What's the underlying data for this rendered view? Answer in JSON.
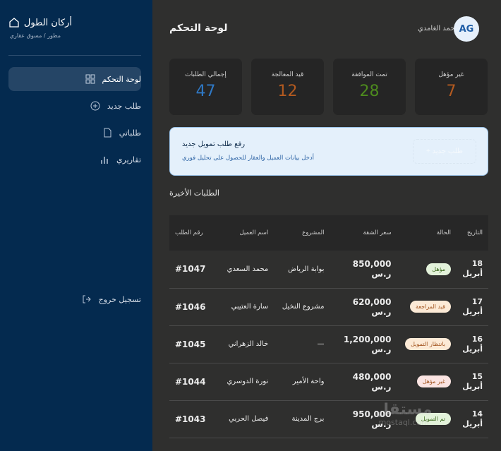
{
  "sidebar": {
    "brand": "أركان الطول",
    "subtitle": "مطور / مسوق عقاري",
    "items": [
      {
        "label": "لوحة التحكم",
        "icon": "grid-icon"
      },
      {
        "label": "طلب جديد",
        "icon": "plus-circle-icon"
      },
      {
        "label": "طلباتي",
        "icon": "file-icon"
      },
      {
        "label": "تقاريري",
        "icon": "bar-chart-icon"
      }
    ],
    "logout": "تسجيل خروج"
  },
  "header": {
    "title": "لوحة التحكم",
    "user_name": "أحمد الغامدي",
    "avatar_initials": "AG"
  },
  "stats": [
    {
      "label": "إجمالي الطلبات",
      "value": "47",
      "color": "#2f78c4"
    },
    {
      "label": "قيد المعالجة",
      "value": "12",
      "color": "#b35a20"
    },
    {
      "label": "تمت الموافقة",
      "value": "28",
      "color": "#4d8a1e"
    },
    {
      "label": "غير مؤهل",
      "value": "7",
      "color": "#b35a20"
    }
  ],
  "banner": {
    "title": "رفع طلب تمويل جديد",
    "subtitle": "أدخل بيانات العميل والعقار للحصول على تحليل فوري",
    "button": "طلب جديد +"
  },
  "recent": {
    "title": "الطلبات الأخيرة",
    "columns": [
      "التاريخ",
      "الحالة",
      "سعر الشقة",
      "المشروع",
      "اسم العميل",
      "رقم الطلب"
    ],
    "rows": [
      {
        "date": "18 أبريل",
        "status": "مؤهل",
        "price": "850,000 ر.س",
        "project": "بوابة الرياض",
        "client": "محمد السعدي",
        "id": "#1047"
      },
      {
        "date": "17 أبريل",
        "status": "قيد المراجعة",
        "price": "620,000 ر.س",
        "project": "مشروع النخيل",
        "client": "سارة العتيبي",
        "id": "#1046"
      },
      {
        "date": "16 أبريل",
        "status": "بانتظار التمويل",
        "price": "1,200,000 ر.س",
        "project": "—",
        "client": "خالد الزهراني",
        "id": "#1045"
      },
      {
        "date": "15 أبريل",
        "status": "غير مؤهل",
        "price": "480,000 ر.س",
        "project": "واحة الأمير",
        "client": "نورة الدوسري",
        "id": "#1044"
      },
      {
        "date": "14 أبريل",
        "status": "تم التمويل",
        "price": "950,000 ر.س",
        "project": "برج المدينة",
        "client": "فيصل الحربي",
        "id": "#1043"
      }
    ]
  },
  "badge_colors": {
    "مؤهل": [
      "#e3f2da",
      "#3d6b1f"
    ],
    "قيد المراجعة": [
      "#fcead6",
      "#a0521c"
    ],
    "بانتظار التمويل": [
      "#fcead6",
      "#a0521c"
    ],
    "غير مؤهل": [
      "#fbe4e2",
      "#a0521c"
    ],
    "تم التمويل": [
      "#e3f2da",
      "#3d6b1f"
    ]
  },
  "watermark": {
    "text": "مستقل",
    "domain": "mostaql.com"
  }
}
